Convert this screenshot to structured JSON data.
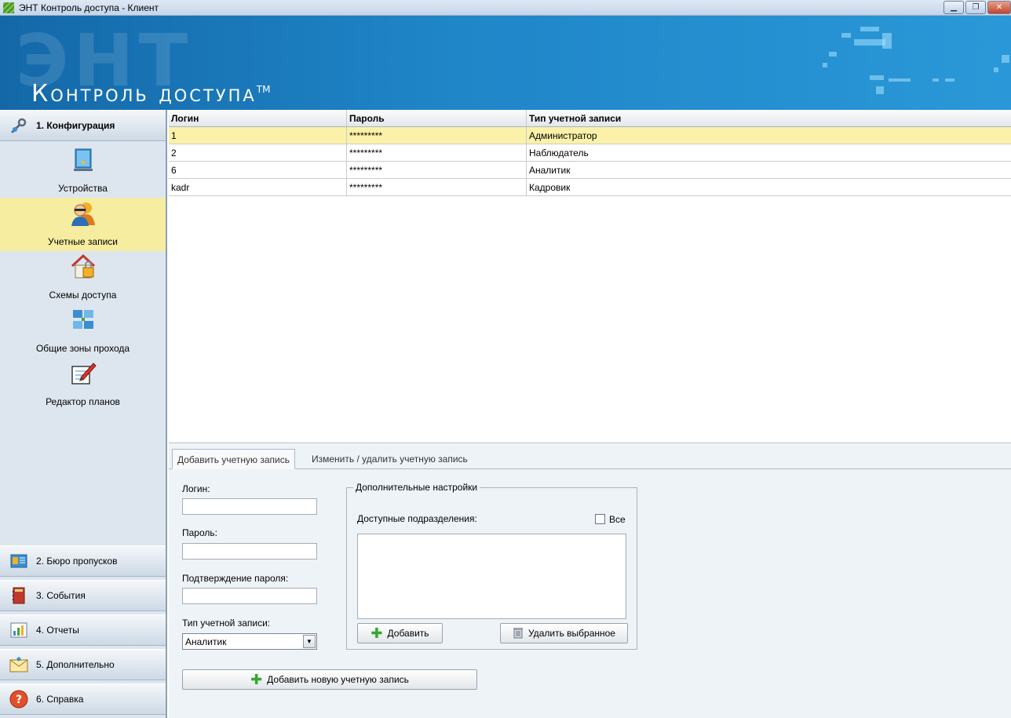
{
  "window": {
    "title": "ЭНТ Контроль доступа - Клиент",
    "minimize": "▁",
    "restore": "❐",
    "close": "✕"
  },
  "banner": {
    "logo_text": "Контроль доступа",
    "trademark": "TM",
    "ghost_text": "ЭНТ"
  },
  "sidebar": {
    "config_section": "1. Конфигурация",
    "items": [
      {
        "label": "Устройства",
        "icon": "server-icon"
      },
      {
        "label": "Учетные записи",
        "icon": "users-icon"
      },
      {
        "label": "Схемы доступа",
        "icon": "house-lock-icon"
      },
      {
        "label": "Общие зоны прохода",
        "icon": "network-icon"
      },
      {
        "label": "Редактор планов",
        "icon": "pencil-plan-icon"
      }
    ],
    "sections": [
      {
        "label": "2. Бюро пропусков",
        "icon": "id-card-icon"
      },
      {
        "label": "3. События",
        "icon": "book-icon"
      },
      {
        "label": "4. Отчеты",
        "icon": "bar-chart-icon"
      },
      {
        "label": "5. Дополнительно",
        "icon": "envelope-icon"
      },
      {
        "label": "6. Справка",
        "icon": "help-icon"
      }
    ]
  },
  "grid": {
    "columns": [
      "Логин",
      "Пароль",
      "Тип учетной записи"
    ],
    "rows": [
      {
        "login": "1",
        "password": "*********",
        "type": "Администратор",
        "selected": true
      },
      {
        "login": "2",
        "password": "*********",
        "type": "Наблюдатель",
        "selected": false
      },
      {
        "login": "6",
        "password": "*********",
        "type": "Аналитик",
        "selected": false
      },
      {
        "login": "kadr",
        "password": "*********",
        "type": "Кадровик",
        "selected": false
      }
    ]
  },
  "tabs": {
    "add": "Добавить учетную запись",
    "edit": "Изменить / удалить учетную запись"
  },
  "form": {
    "login_label": "Логин:",
    "login_value": "",
    "password_label": "Пароль:",
    "password_value": "",
    "confirm_label": "Подтверждение пароля:",
    "confirm_value": "",
    "type_label": "Тип учетной записи:",
    "type_value": "Аналитик",
    "submit_label": "Добавить новую учетную запись"
  },
  "extra": {
    "legend": "Дополнительные настройки",
    "departments_label": "Доступные подразделения:",
    "all_label": "Все",
    "all_checked": false,
    "add_label": "Добавить",
    "remove_label": "Удалить выбранное"
  }
}
